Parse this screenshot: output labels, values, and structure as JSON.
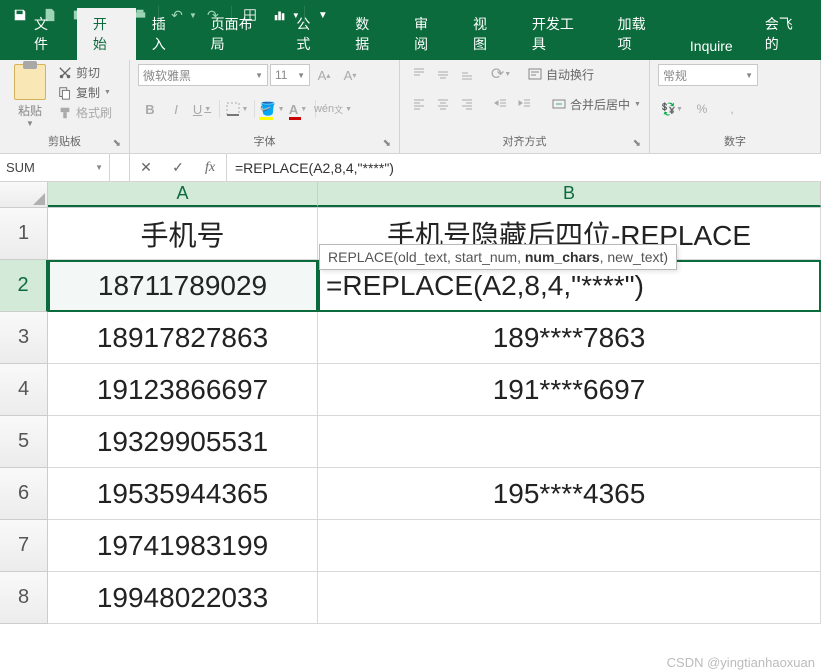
{
  "titlebar": {
    "save": "💾",
    "undo": "↶",
    "redo": "↷"
  },
  "tabs": {
    "file": "文件",
    "home": "开始",
    "insert": "插入",
    "layout": "页面布局",
    "formulas": "公式",
    "data": "数据",
    "review": "审阅",
    "view": "视图",
    "devtools": "开发工具",
    "addins": "加载项",
    "inquire": "Inquire",
    "fly": "会飞的"
  },
  "ribbon": {
    "clipboard": {
      "paste": "粘贴",
      "cut": "剪切",
      "copy": "复制",
      "format_painter": "格式刷",
      "label": "剪贴板"
    },
    "font": {
      "name": "微软雅黑",
      "size": "11",
      "label": "字体"
    },
    "align": {
      "wrap": "自动换行",
      "merge": "合并后居中",
      "label": "对齐方式"
    },
    "number": {
      "format": "常规",
      "label": "数字"
    }
  },
  "namebox": "SUM",
  "formula": "=REPLACE(A2,8,4,\"****\")",
  "tooltip": {
    "fn": "REPLACE",
    "args_pre": "(old_text, start_num, ",
    "args_bold": "num_chars",
    "args_post": ", new_text)"
  },
  "headers": {
    "A": "A",
    "B": "B"
  },
  "rows": [
    "1",
    "2",
    "3",
    "4",
    "5",
    "6",
    "7",
    "8"
  ],
  "cells": {
    "A1": "手机号",
    "B1": "手机号隐藏后四位-REPLACE",
    "A2": "18711789029",
    "B2": "=REPLACE(A2,8,4,\"****\")",
    "A3": "18917827863",
    "B3": "189****7863",
    "A4": "19123866697",
    "B4": "191****6697",
    "A5": "19329905531",
    "B5": "",
    "A6": "19535944365",
    "B6": "195****4365",
    "A7": "19741983199",
    "B7": "",
    "A8": "19948022033",
    "B8": ""
  },
  "watermark": "CSDN @yingtianhaoxuan"
}
